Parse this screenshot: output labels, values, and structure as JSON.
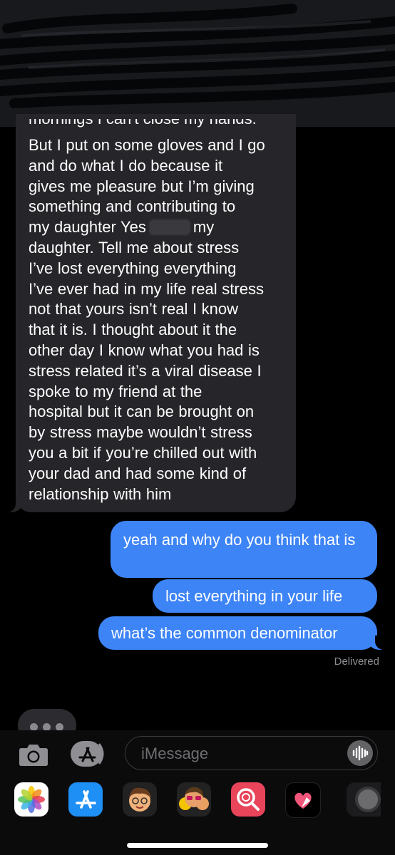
{
  "incoming_message": {
    "cutoff_line": "mornings I can't close my hands.",
    "lines": [
      "But I put on some gloves and I go",
      "and do what I do because it",
      "gives me pleasure but I’m giving",
      "something and contributing to",
      "my daughter Yes",
      "my",
      "daughter. Tell me about stress",
      "I’ve lost everything everything",
      "I’ve ever had in my life real stress",
      "not that yours isn’t real I know",
      "that it is. I thought about it the",
      "other day I know what you had is",
      "stress related it’s a viral disease I",
      "spoke to my friend at the",
      "hospital but it can be brought on",
      "by stress maybe wouldn’t stress",
      "you a bit if you’re chilled out with",
      "your dad and had some kind of",
      "relationship with him"
    ]
  },
  "outgoing_messages": [
    {
      "text": "yeah and why do you think that is"
    },
    {
      "text": "lost everything in your life"
    },
    {
      "text": "what’s the common denominator"
    }
  ],
  "status": {
    "delivered": "Delivered"
  },
  "composer": {
    "placeholder": "iMessage"
  },
  "app_tray": [
    "photos-icon",
    "app-store-icon",
    "memoji-icon",
    "animoji-icon",
    "image-search-icon",
    "digital-touch-icon",
    "music-icon"
  ],
  "colors": {
    "outgoing_bubble": "#3d84f7",
    "incoming_bubble": "#26262a",
    "background": "#000000"
  }
}
